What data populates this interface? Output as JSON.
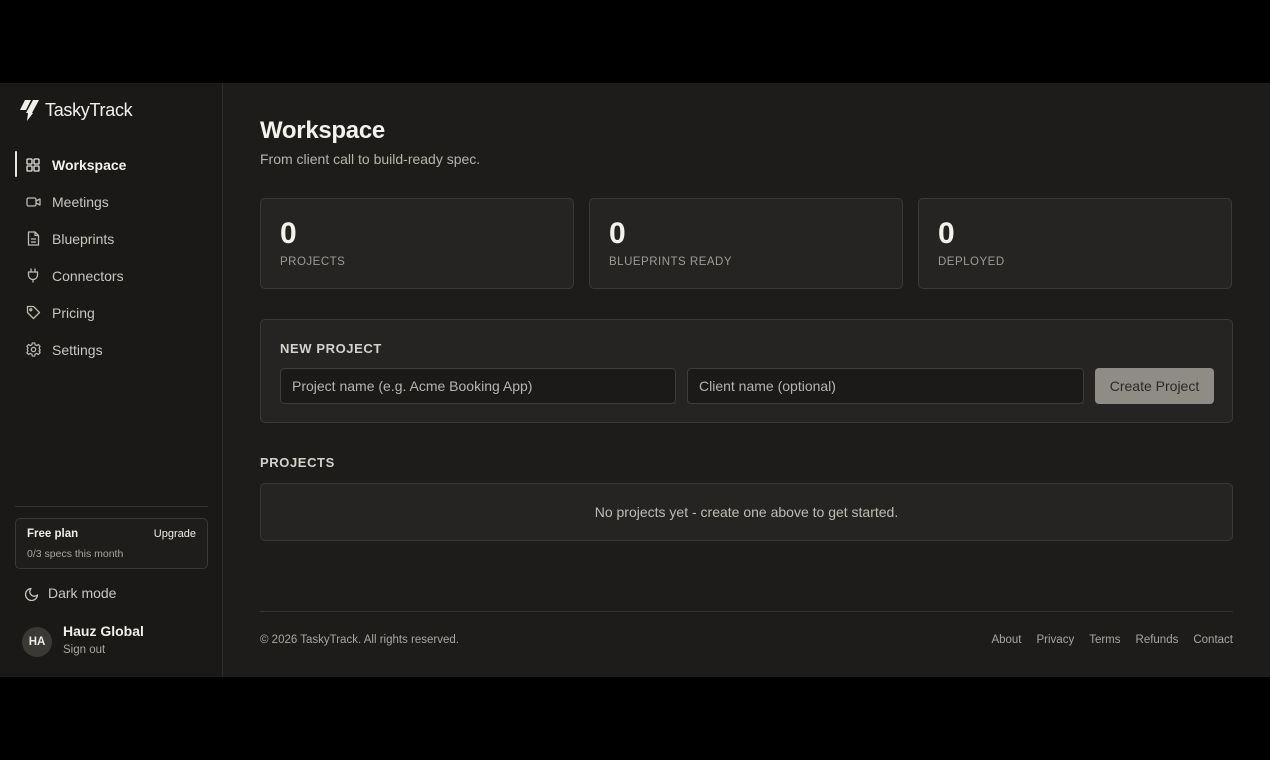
{
  "brand": {
    "name": "TaskyTrack",
    "logo_icon": "lightning-logo"
  },
  "sidebar": {
    "items": [
      {
        "label": "Workspace",
        "icon": "grid-icon",
        "active": true
      },
      {
        "label": "Meetings",
        "icon": "video-icon",
        "active": false
      },
      {
        "label": "Blueprints",
        "icon": "document-icon",
        "active": false
      },
      {
        "label": "Connectors",
        "icon": "plug-icon",
        "active": false
      },
      {
        "label": "Pricing",
        "icon": "tag-icon",
        "active": false
      },
      {
        "label": "Settings",
        "icon": "gear-icon",
        "active": false
      }
    ],
    "plan": {
      "name": "Free plan",
      "upgrade_label": "Upgrade",
      "usage": "0/3 specs this month"
    },
    "dark_mode_label": "Dark mode",
    "user": {
      "initials": "HA",
      "name": "Hauz Global",
      "sign_out_label": "Sign out"
    }
  },
  "main": {
    "title": "Workspace",
    "subtitle": "From client call to build-ready spec.",
    "stats": [
      {
        "value": "0",
        "label": "PROJECTS"
      },
      {
        "value": "0",
        "label": "BLUEPRINTS READY"
      },
      {
        "value": "0",
        "label": "DEPLOYED"
      }
    ],
    "new_project": {
      "title": "NEW PROJECT",
      "project_name_placeholder": "Project name (e.g. Acme Booking App)",
      "client_name_placeholder": "Client name (optional)",
      "create_label": "Create Project"
    },
    "projects": {
      "title": "PROJECTS",
      "empty_message": "No projects yet - create one above to get started."
    }
  },
  "footer": {
    "copyright": "© 2026 TaskyTrack. All rights reserved.",
    "links": [
      "About",
      "Privacy",
      "Terms",
      "Refunds",
      "Contact"
    ]
  },
  "colors": {
    "background": "#1d1c1a",
    "sidebar": "#1a1917",
    "card": "#252422",
    "border": "#3a3935",
    "button": "#8f8c86",
    "text": "#f4f2ec"
  }
}
